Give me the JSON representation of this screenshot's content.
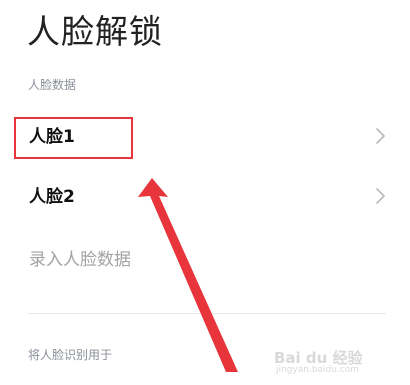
{
  "page": {
    "title": "人脸解锁"
  },
  "face_data_section": {
    "header": "人脸数据",
    "items": [
      {
        "label": "人脸1"
      },
      {
        "label": "人脸2"
      }
    ],
    "add_label": "录入人脸数据"
  },
  "usage_section": {
    "header": "将人脸识别用于"
  },
  "annotation": {
    "highlight_color": "#e8343b"
  },
  "watermark": {
    "text": "Bai du 经验",
    "sub": "jingyan.baidu.com"
  },
  "icons": {
    "chevron": "chevron-right-icon"
  }
}
